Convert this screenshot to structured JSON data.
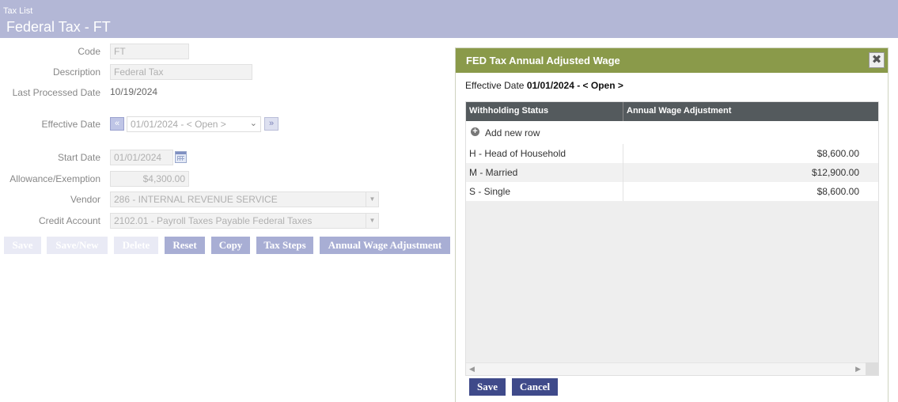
{
  "header": {
    "breadcrumb": "Tax List",
    "title": "Federal Tax - FT"
  },
  "form": {
    "code": {
      "label": "Code",
      "value": "FT"
    },
    "description": {
      "label": "Description",
      "value": "Federal Tax"
    },
    "last_processed": {
      "label": "Last Processed Date",
      "value": "10/19/2024"
    },
    "effective_date": {
      "label": "Effective Date",
      "value": "01/01/2024 - < Open >",
      "prev_icon": "chevron-left-double",
      "next_icon": "chevron-right-double"
    },
    "start_date": {
      "label": "Start Date",
      "value": "01/01/2024"
    },
    "allowance": {
      "label": "Allowance/Exemption",
      "value": "$4,300.00"
    },
    "vendor": {
      "label": "Vendor",
      "value": "286 - INTERNAL REVENUE SERVICE"
    },
    "credit_account": {
      "label": "Credit Account",
      "value": "2102.01 - Payroll Taxes Payable Federal Taxes"
    }
  },
  "buttons": {
    "save": "Save",
    "save_new": "Save/New",
    "delete": "Delete",
    "reset": "Reset",
    "copy": "Copy",
    "tax_steps": "Tax Steps",
    "annual_wage": "Annual Wage Adjustment"
  },
  "dialog": {
    "title": "FED Tax Annual Adjusted Wage",
    "close_icon": "close-x",
    "effective_label": "Effective Date",
    "effective_value": "01/01/2024 - < Open >",
    "columns": [
      "Withholding Status",
      "Annual Wage Adjustment"
    ],
    "add_row": "Add new row",
    "rows": [
      {
        "status": "H - Head of Household",
        "amount": "$8,600.00"
      },
      {
        "status": "M - Married",
        "amount": "$12,900.00"
      },
      {
        "status": "S - Single",
        "amount": "$8,600.00"
      }
    ],
    "save": "Save",
    "cancel": "Cancel"
  },
  "colors": {
    "header_bg": "#b3b7d6",
    "dialog_header_bg": "#8a9a4a",
    "grid_header_bg": "#545a5d",
    "primary_button": "#3f4a8a"
  }
}
